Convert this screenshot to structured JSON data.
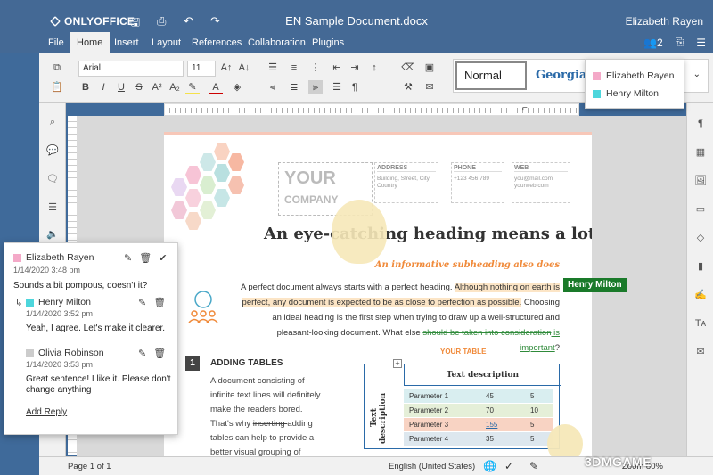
{
  "app": {
    "logo": "ONLYOFFICE",
    "doc_title": "EN Sample Document.docx",
    "user": "Elizabeth Rayen"
  },
  "menu": {
    "tabs": [
      "File",
      "Home",
      "Insert",
      "Layout",
      "References",
      "Collaboration",
      "Plugins"
    ],
    "active": "Home",
    "share_count": "2"
  },
  "toolbar": {
    "font_name": "Arial",
    "font_size": "11",
    "styles": [
      "Normal",
      "Georgia"
    ]
  },
  "share_popup": {
    "users": [
      {
        "name": "Elizabeth Rayen",
        "color": "#f4a9c8"
      },
      {
        "name": "Henry Milton",
        "color": "#4dd6dc"
      }
    ]
  },
  "document": {
    "company_your": "YOUR",
    "company_name": "COMPANY",
    "contacts": [
      {
        "head": "ADDRESS",
        "body": "Building, Street, City, Country"
      },
      {
        "head": "PHONE",
        "body": "+123 456 789"
      },
      {
        "head": "WEB",
        "body": "you@mail.com yourweb.com"
      }
    ],
    "heading": "An eye-catching heading means a lot",
    "subheading": "An informative subheading also does",
    "para1": "A perfect document always starts with a perfect heading. ",
    "para1_hl": "Although nothing on earth is perfect, any document is expected to be as close to perfection as possible.",
    "para1_b": " Choosing an ideal heading is the first step when trying to draw up a well-structured and pleasant-looking document. What else ",
    "para1_del": "should be taken into consideration",
    "para1_ins": " is important",
    "para1_end": "?",
    "section_num": "1",
    "section_title": "ADDING TABLES",
    "section_text_a": "A document consisting of infinite text lines will definitely make the readers bored. That's why ",
    "section_text_del": "inserting ",
    "section_text_b": "adding tables can help to provide a better visual grouping of information.",
    "table_label": "YOUR TABLE",
    "table_desc": "Text description",
    "table_side": "Text description",
    "table_rows": [
      {
        "name": "Parameter 1",
        "a": "45",
        "b": "5",
        "color": "#d9eef0"
      },
      {
        "name": "Parameter 2",
        "a": "70",
        "b": "10",
        "color": "#e5efd8"
      },
      {
        "name": "Parameter 3",
        "a": "155",
        "b": "5",
        "color": "#f8d3c3"
      },
      {
        "name": "Parameter 4",
        "a": "35",
        "b": "5",
        "color": "#dde7ee"
      }
    ]
  },
  "tooltip": "Henry Milton",
  "comments": {
    "main": {
      "user": "Elizabeth Rayen",
      "date": "1/14/2020 3:48 pm",
      "text": "Sounds a bit pompous, doesn't it?",
      "color": "#f4a9c8"
    },
    "replies": [
      {
        "user": "Henry Milton",
        "date": "1/14/2020 3:52 pm",
        "text": "Yeah, I agree. Let's make it clearer.",
        "color": "#4dd6dc"
      },
      {
        "user": "Olivia Robinson",
        "date": "1/14/2020 3:53 pm",
        "text": "Great sentence! I like it. Please don't change anything",
        "color": "#cccccc"
      }
    ],
    "add_reply": "Add Reply"
  },
  "status": {
    "page": "Page 1 of 1",
    "language": "English (United States)",
    "zoom": "Zoom 80%"
  },
  "watermark": "3DMGAME"
}
